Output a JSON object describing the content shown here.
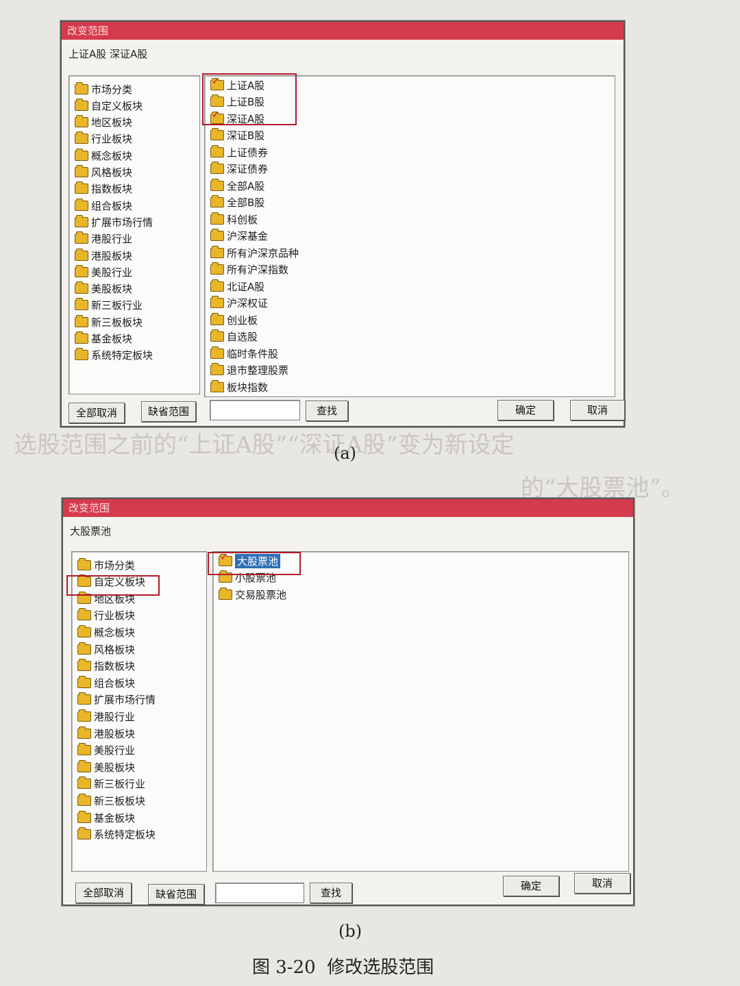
{
  "figure_a": {
    "title": "改变范围",
    "selected_text": "上证A股 深证A股",
    "left_items": [
      "市场分类",
      "自定义板块",
      "地区板块",
      "行业板块",
      "概念板块",
      "风格板块",
      "指数板块",
      "组合板块",
      "扩展市场行情",
      "港股行业",
      "港股板块",
      "美股行业",
      "美股板块",
      "新三板行业",
      "新三板板块",
      "基金板块",
      "系统特定板块"
    ],
    "right_items": [
      {
        "label": "上证A股",
        "checked": true
      },
      {
        "label": "上证B股",
        "checked": false
      },
      {
        "label": "深证A股",
        "checked": true
      },
      {
        "label": "深证B股",
        "checked": false
      },
      {
        "label": "上证债券",
        "checked": false
      },
      {
        "label": "深证债券",
        "checked": false
      },
      {
        "label": "全部A股",
        "checked": false
      },
      {
        "label": "全部B股",
        "checked": false
      },
      {
        "label": "科创板",
        "checked": false
      },
      {
        "label": "沪深基金",
        "checked": false
      },
      {
        "label": "所有沪深京品种",
        "checked": false
      },
      {
        "label": "所有沪深指数",
        "checked": false
      },
      {
        "label": "北证A股",
        "checked": false
      },
      {
        "label": "沪深权证",
        "checked": false
      },
      {
        "label": "创业板",
        "checked": false
      },
      {
        "label": "自选股",
        "checked": false
      },
      {
        "label": "临时条件股",
        "checked": false
      },
      {
        "label": "退市整理股票",
        "checked": false
      },
      {
        "label": "板块指数",
        "checked": false
      }
    ],
    "buttons": {
      "clear_all": "全部取消",
      "default_range": "缺省范围",
      "find": "查找",
      "ok": "确定",
      "cancel": "取消"
    },
    "search_value": "",
    "caption": "(a)"
  },
  "figure_b": {
    "title": "改变范围",
    "selected_text": "大股票池",
    "left_items": [
      "市场分类",
      "自定义板块",
      "地区板块",
      "行业板块",
      "概念板块",
      "风格板块",
      "指数板块",
      "组合板块",
      "扩展市场行情",
      "港股行业",
      "港股板块",
      "美股行业",
      "美股板块",
      "新三板行业",
      "新三板板块",
      "基金板块",
      "系统特定板块"
    ],
    "right_items": [
      {
        "label": "大股票池",
        "checked": true,
        "selected": true
      },
      {
        "label": "小股票池",
        "checked": false
      },
      {
        "label": "交易股票池",
        "checked": false
      }
    ],
    "buttons": {
      "clear_all": "全部取消",
      "default_range": "缺省范围",
      "find": "查找",
      "ok": "确定",
      "cancel": "取消"
    },
    "search_value": "",
    "caption": "(b)"
  },
  "figure_caption": "图 3-20  修改选股范围",
  "page_text": {
    "line1": "选股范围之前的“上证A股”“深证A股”变为新设定",
    "line2": "的“大股票池”。"
  }
}
